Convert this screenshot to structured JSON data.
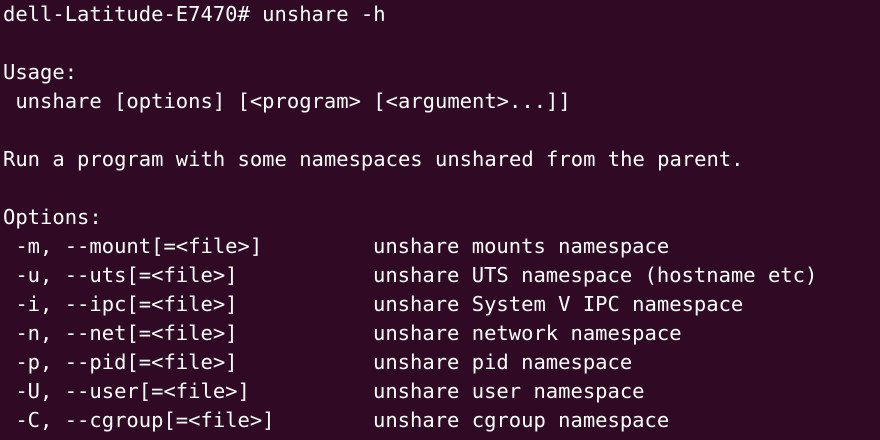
{
  "terminal": {
    "prompt": "dell-Latitude-E7470# unshare -h",
    "usage_heading": "Usage:",
    "usage_line": " unshare [options] [<program> [<argument>...]]",
    "description": "Run a program with some namespaces unshared from the parent.",
    "options_heading": "Options:",
    "options": [
      {
        "flag": " -m, --mount[=<file>]",
        "desc": "unshare mounts namespace"
      },
      {
        "flag": " -u, --uts[=<file>]",
        "desc": "unshare UTS namespace (hostname etc)"
      },
      {
        "flag": " -i, --ipc[=<file>]",
        "desc": "unshare System V IPC namespace"
      },
      {
        "flag": " -n, --net[=<file>]",
        "desc": "unshare network namespace"
      },
      {
        "flag": " -p, --pid[=<file>]",
        "desc": "unshare pid namespace"
      },
      {
        "flag": " -U, --user[=<file>]",
        "desc": "unshare user namespace"
      },
      {
        "flag": " -C, --cgroup[=<file>]",
        "desc": "unshare cgroup namespace"
      }
    ]
  },
  "colors": {
    "background": "#300a24",
    "foreground": "#ffffff"
  }
}
